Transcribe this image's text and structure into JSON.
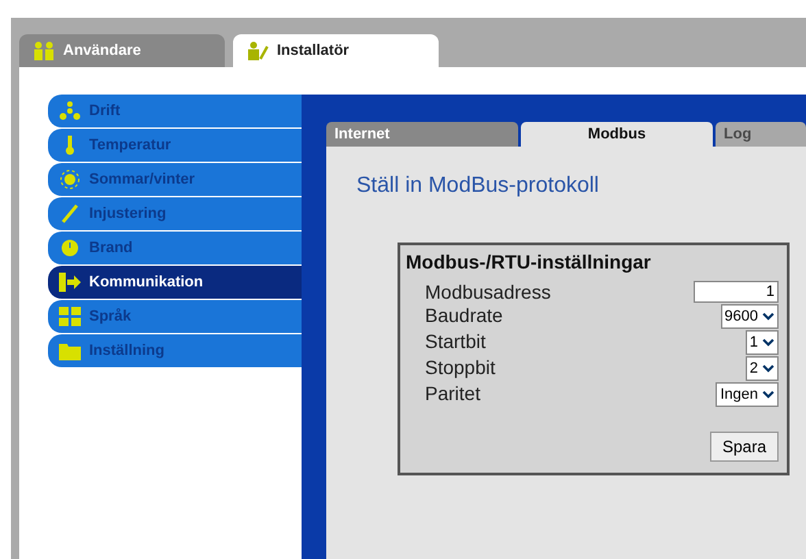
{
  "top_tabs": [
    {
      "label": "Användare",
      "kind": "users",
      "selected": false
    },
    {
      "label": "Installatör",
      "kind": "installer",
      "selected": true
    }
  ],
  "sidebar": {
    "items": [
      {
        "label": "Drift",
        "kind": "fan",
        "selected": false
      },
      {
        "label": "Temperatur",
        "kind": "thermometer",
        "selected": false
      },
      {
        "label": "Sommar/vinter",
        "kind": "sun",
        "selected": false
      },
      {
        "label": "Injustering",
        "kind": "brush",
        "selected": false
      },
      {
        "label": "Brand",
        "kind": "clock",
        "selected": false
      },
      {
        "label": "Kommunikation",
        "kind": "arrow",
        "selected": true
      },
      {
        "label": "Språk",
        "kind": "grid",
        "selected": false
      },
      {
        "label": "Inställning",
        "kind": "folder",
        "selected": false
      }
    ]
  },
  "sub_tabs": [
    {
      "label": "Internet",
      "selected": false,
      "disabled": false
    },
    {
      "label": "Modbus",
      "selected": true,
      "disabled": false
    },
    {
      "label": "Log",
      "selected": false,
      "disabled": true
    }
  ],
  "heading": "Ställ in ModBus-protokoll",
  "settings": {
    "title": "Modbus-/RTU-inställningar",
    "fields": [
      {
        "label": "Modbusadress",
        "kind": "input",
        "value": "1"
      },
      {
        "label": "Baudrate",
        "kind": "select",
        "value": "9600"
      },
      {
        "label": "Startbit",
        "kind": "select",
        "value": "1"
      },
      {
        "label": "Stoppbit",
        "kind": "select",
        "value": "2"
      },
      {
        "label": "Paritet",
        "kind": "select",
        "value": "Ingen"
      }
    ],
    "save_button": "Spara"
  }
}
